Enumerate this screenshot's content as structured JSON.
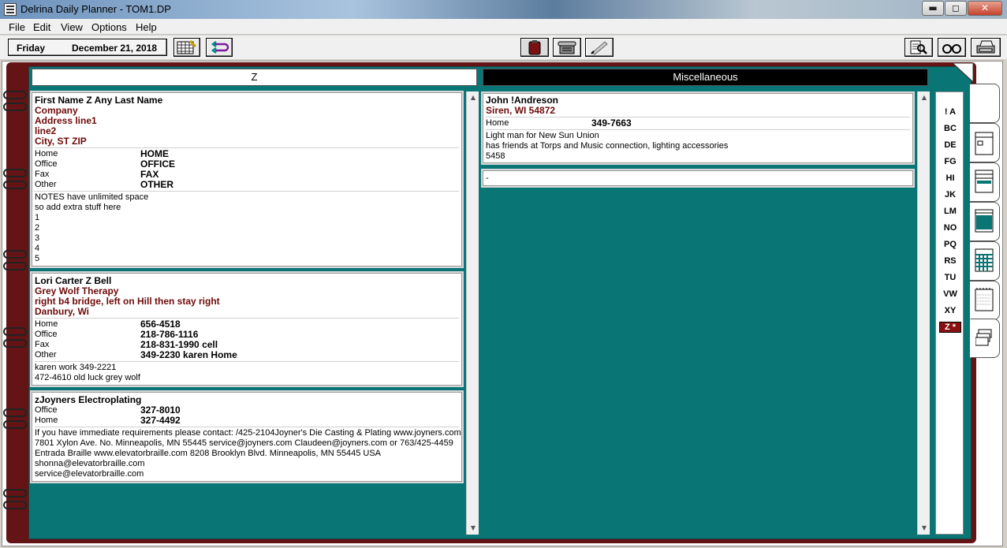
{
  "window": {
    "title": "Delrina Daily Planner - TOM1.DP",
    "controls": {
      "minimize": "▬",
      "maximize": "◻",
      "close": "✕"
    }
  },
  "menu": [
    "File",
    "Edit",
    "View",
    "Options",
    "Help"
  ],
  "toolbar": {
    "day": "Friday",
    "date": "December 21, 2018"
  },
  "left_header": "Z",
  "right_header": "Miscellaneous",
  "cards": [
    {
      "name": "First Name Z Any Last Name",
      "company": "Company",
      "address": [
        "Address line1",
        "line2",
        "City, ST  ZIP"
      ],
      "phones": [
        {
          "label": "Home",
          "value": "HOME"
        },
        {
          "label": "Office",
          "value": "OFFICE"
        },
        {
          "label": "Fax",
          "value": "FAX"
        },
        {
          "label": "Other",
          "value": "OTHER"
        }
      ],
      "notes": [
        "NOTES have unlimited space",
        "so add extra stuff here",
        "1",
        "2",
        "3",
        "4",
        "5"
      ]
    },
    {
      "name": "Lori Carter Z Bell",
      "company": "Grey Wolf Therapy",
      "address": [
        "right b4 bridge,  left on Hill then stay right",
        "Danbury, Wi"
      ],
      "phones": [
        {
          "label": "Home",
          "value": "656-4518"
        },
        {
          "label": "Office",
          "value": "218-786-1116"
        },
        {
          "label": "Fax",
          "value": "218-831-1990 cell"
        },
        {
          "label": "Other",
          "value": "349-2230 karen Home"
        }
      ],
      "notes": [
        "karen work 349-2221",
        "472-4610 old luck grey wolf"
      ]
    },
    {
      "name": "zJoyners Electroplating",
      "phones": [
        {
          "label": "Office",
          "value": "327-8010"
        },
        {
          "label": "Home",
          "value": "327-4492"
        }
      ],
      "notes": [
        "If you have immediate requirements please contact:  /425-2104Joyner's Die Casting & Plating www.joyners.com",
        "7801 Xylon Ave. No. Minneapolis, MN 55445 service@joyners.com Claudeen@joyners.com or 763/425-4459",
        "Entrada Braille       www.elevatorbraille.com 8208 Brooklyn Blvd. Minneapolis, MN 55445 USA",
        "shonna@elevatorbraille.com",
        "service@elevatorbraille.com"
      ]
    }
  ],
  "misc_card": {
    "name": "John !Andreson",
    "address": "Siren, WI  54872",
    "phones": [
      {
        "label": "Home",
        "value": "349-7663"
      }
    ],
    "notes": [
      "Light man for New Sun Union",
      "has friends at Torps and Music connection, lighting accessories",
      "5458"
    ]
  },
  "misc_empty": "-",
  "alpha_tabs": [
    "! A",
    "BC",
    "DE",
    "FG",
    "HI",
    "JK",
    "LM",
    "NO",
    "PQ",
    "RS",
    "TU",
    "VW",
    "XY",
    "Z *"
  ],
  "scroll_arrows": {
    "up": "▲",
    "down": "▼"
  },
  "colors": {
    "teal": "#0a7575",
    "binder": "#641414",
    "active_tab": "#8a1010",
    "card_text_dark": "#6e0a0a"
  }
}
